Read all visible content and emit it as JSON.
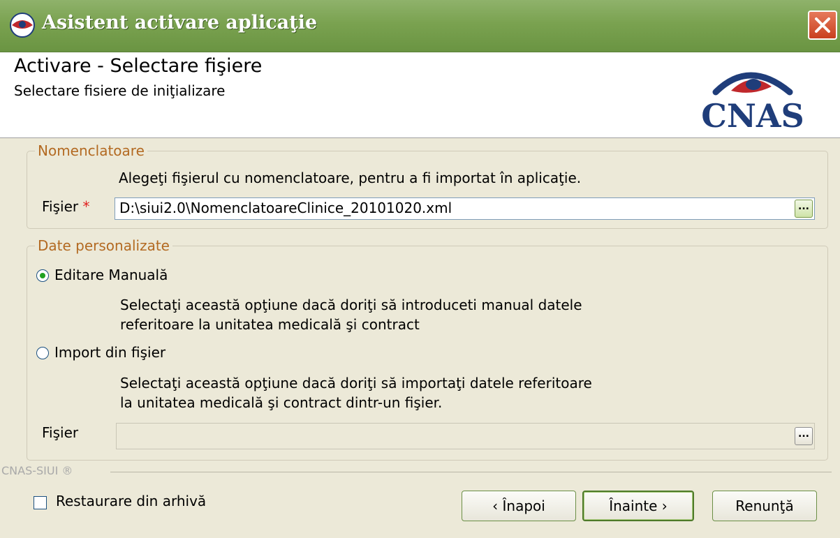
{
  "window": {
    "title": "Asistent activare aplicaţie",
    "icon": "cnas-eye-icon"
  },
  "header": {
    "title": "Activare - Selectare fişiere",
    "subtitle": "Selectare fisiere de iniţializare",
    "logo_text": "CNAS"
  },
  "nomenclatoare": {
    "legend": "Nomenclatoare",
    "description": "Alegeţi fişierul cu nomenclatoare, pentru a fi importat în aplicaţie.",
    "file_label": "Fişier",
    "required_mark": "*",
    "file_value": "D:\\siui2.0\\NomenclatoareClinice_20101020.xml",
    "browse_label": "..."
  },
  "date_personalizate": {
    "legend": "Date personalizate",
    "option_manual": {
      "label": "Editare Manuală",
      "selected": true,
      "description_line1": "Selectaţi această opţiune dacă doriţi să introduceti manual datele",
      "description_line2": "referitoare la unitatea medicală şi contract"
    },
    "option_import": {
      "label": "Import din fişier",
      "selected": false,
      "description_line1": "Selectaţi această opţiune dacă doriţi să importaţi datele referitoare",
      "description_line2": "la unitatea medicală şi contract dintr-un fişier."
    },
    "file_label": "Fişier",
    "file_value": "",
    "browse_label": "..."
  },
  "footer": {
    "brand": "CNAS-SIUI ®",
    "restore_label": "Restaurare din arhivă",
    "restore_checked": false,
    "back_label": "‹ Înapoi",
    "next_label": "Înainte ›",
    "cancel_label": "Renunţă"
  },
  "colors": {
    "titlebar": "#7aa250",
    "legend": "#b36a22",
    "required": "#e02020",
    "logo_blue": "#1f3d7a",
    "logo_red": "#c0282c"
  }
}
